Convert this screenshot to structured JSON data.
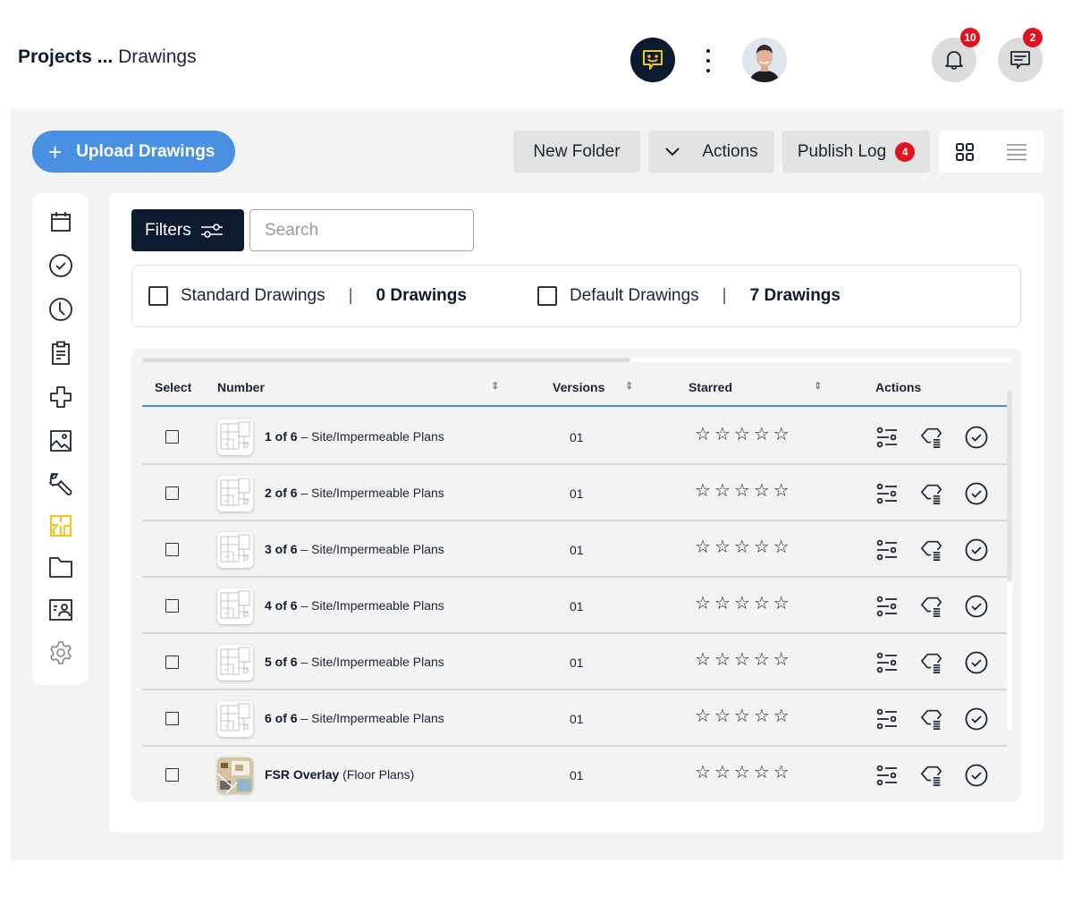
{
  "header": {
    "breadcrumb_parent": "Projects ...",
    "breadcrumb_current": "Drawings",
    "notifications_count": "10",
    "messages_count": "2"
  },
  "toolbar": {
    "upload_label": "Upload Drawings",
    "new_folder_label": "New Folder",
    "actions_label": "Actions",
    "publish_log_label": "Publish Log",
    "publish_log_count": "4"
  },
  "sidebar": {
    "items": [
      {
        "icon": "calendar-icon",
        "active": false
      },
      {
        "icon": "check-circle-icon",
        "active": false
      },
      {
        "icon": "clock-icon",
        "active": false
      },
      {
        "icon": "clipboard-icon",
        "active": false
      },
      {
        "icon": "medical-cross-icon",
        "active": false
      },
      {
        "icon": "image-icon",
        "active": false
      },
      {
        "icon": "wrench-icon",
        "active": false
      },
      {
        "icon": "floor-plan-icon",
        "active": true
      },
      {
        "icon": "folder-icon",
        "active": false
      },
      {
        "icon": "id-card-icon",
        "active": false
      },
      {
        "icon": "gear-icon",
        "active": false
      }
    ],
    "active_color": "#f5c518"
  },
  "filters": {
    "filters_label": "Filters",
    "search_placeholder": "Search",
    "search_value": ""
  },
  "drawing_types": [
    {
      "label": "Standard Drawings",
      "separator": "|",
      "count": "0 Drawings",
      "checked": false
    },
    {
      "label": "Default Drawings",
      "separator": "|",
      "count": "7 Drawings",
      "checked": false
    }
  ],
  "table": {
    "columns": {
      "select": "Select",
      "number": "Number",
      "versions": "Versions",
      "starred": "Starred",
      "actions": "Actions"
    },
    "rows": [
      {
        "number": "1 of 6",
        "name": " – Site/Impermeable Plans",
        "version": "01",
        "stars": 0,
        "thumb": "plan"
      },
      {
        "number": "2 of 6",
        "name": " – Site/Impermeable Plans",
        "version": "01",
        "stars": 0,
        "thumb": "plan"
      },
      {
        "number": "3 of 6",
        "name": " – Site/Impermeable Plans",
        "version": "01",
        "stars": 0,
        "thumb": "plan"
      },
      {
        "number": "4 of 6",
        "name": " – Site/Impermeable Plans",
        "version": "01",
        "stars": 0,
        "thumb": "plan"
      },
      {
        "number": "5 of 6",
        "name": " – Site/Impermeable Plans",
        "version": "01",
        "stars": 0,
        "thumb": "plan"
      },
      {
        "number": "6 of 6",
        "name": " – Site/Impermeable Plans",
        "version": "01",
        "stars": 0,
        "thumb": "plan"
      },
      {
        "number": "FSR Overlay",
        "name": " (Floor Plans)",
        "version": "01",
        "stars": 0,
        "thumb": "render"
      }
    ],
    "star_glyph": "☆",
    "max_stars": 5
  },
  "colors": {
    "primary_blue": "#4a90e2",
    "navy": "#0c1a30",
    "badge_red": "#e0141e",
    "accent_yellow": "#f5c518"
  }
}
